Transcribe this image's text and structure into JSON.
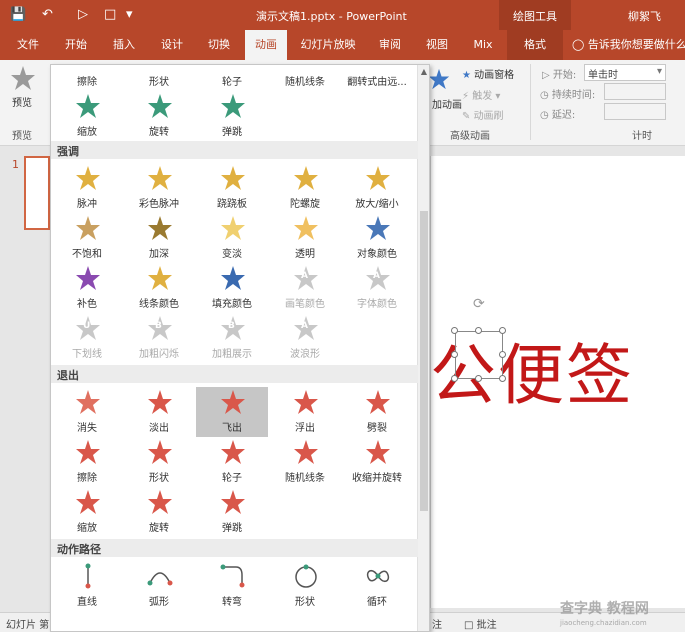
{
  "titlebar": {
    "title": "演示文稿1.pptx - PowerPoint",
    "context_tools": "绘图工具",
    "user": "柳絮飞"
  },
  "tabs": [
    "文件",
    "开始",
    "插入",
    "设计",
    "切换",
    "动画",
    "幻灯片放映",
    "审阅",
    "视图",
    "Mix",
    "格式"
  ],
  "active_tab": "动画",
  "tell_me": "告诉我你想要做什么...",
  "ribbon": {
    "preview": {
      "button": "预览",
      "group": "预览"
    },
    "add_animation": "加动画",
    "animation_pane": "动画窗格",
    "trigger": "触发",
    "animation_painter": "动画刷",
    "advanced_group": "高级动画",
    "timing": {
      "start_label": "开始:",
      "start_value": "单击时",
      "duration_label": "持续时间:",
      "delay_label": "延迟:",
      "group": "计时"
    }
  },
  "slide": {
    "number": "1",
    "text": "公便签"
  },
  "status": {
    "slide_info": "幻灯片 第",
    "notes": "注",
    "comments": "批注"
  },
  "gallery": {
    "top_labels": [
      "擦除",
      "形状",
      "轮子",
      "随机线条",
      "翻转式由远..."
    ],
    "top_row": [
      {
        "label": "缩放",
        "color": "#3b9a7a"
      },
      {
        "label": "旋转",
        "color": "#3b9a7a"
      },
      {
        "label": "弹跳",
        "color": "#3b9a7a"
      }
    ],
    "sections": [
      {
        "title": "强调",
        "rows": [
          [
            {
              "label": "脉冲",
              "color": "#e0b040"
            },
            {
              "label": "彩色脉冲",
              "color": "#e0b040"
            },
            {
              "label": "跷跷板",
              "color": "#e0b040"
            },
            {
              "label": "陀螺旋",
              "color": "#e0b040"
            },
            {
              "label": "放大/缩小",
              "color": "#e0b040"
            }
          ],
          [
            {
              "label": "不饱和",
              "color": "#c9a060"
            },
            {
              "label": "加深",
              "color": "#9a7a30"
            },
            {
              "label": "变淡",
              "color": "#f0d070"
            },
            {
              "label": "透明",
              "color": "#f0c060"
            },
            {
              "label": "对象颜色",
              "color": "#4a78b8"
            }
          ],
          [
            {
              "label": "补色",
              "color": "#8a4ab0"
            },
            {
              "label": "线条颜色",
              "color": "#e0b040"
            },
            {
              "label": "填充颜色",
              "color": "#3a6ab0"
            },
            {
              "label": "画笔颜色",
              "color": "#c8c8c8",
              "disabled": true,
              "letter": "A"
            },
            {
              "label": "字体颜色",
              "color": "#c8c8c8",
              "disabled": true,
              "letter": "A"
            }
          ],
          [
            {
              "label": "下划线",
              "color": "#c8c8c8",
              "disabled": true,
              "letter": "U"
            },
            {
              "label": "加粗闪烁",
              "color": "#c8c8c8",
              "disabled": true,
              "letter": "B"
            },
            {
              "label": "加粗展示",
              "color": "#c8c8c8",
              "disabled": true,
              "letter": "B"
            },
            {
              "label": "波浪形",
              "color": "#c8c8c8",
              "disabled": true,
              "letter": "A"
            }
          ]
        ]
      },
      {
        "title": "退出",
        "rows": [
          [
            {
              "label": "消失",
              "color": "#e07060"
            },
            {
              "label": "淡出",
              "color": "#d9574a"
            },
            {
              "label": "飞出",
              "color": "#d9574a",
              "selected": true
            },
            {
              "label": "浮出",
              "color": "#d9574a"
            },
            {
              "label": "劈裂",
              "color": "#d9574a"
            }
          ],
          [
            {
              "label": "擦除",
              "color": "#d9574a"
            },
            {
              "label": "形状",
              "color": "#d9574a"
            },
            {
              "label": "轮子",
              "color": "#d9574a"
            },
            {
              "label": "随机线条",
              "color": "#d9574a"
            },
            {
              "label": "收缩并旋转",
              "color": "#d9574a"
            }
          ],
          [
            {
              "label": "缩放",
              "color": "#d9574a"
            },
            {
              "label": "旋转",
              "color": "#d9574a"
            },
            {
              "label": "弹跳",
              "color": "#d9574a"
            }
          ]
        ]
      },
      {
        "title": "动作路径",
        "rows": [
          [
            {
              "label": "直线",
              "color": "#3b9a7a",
              "path": "line"
            },
            {
              "label": "弧形",
              "color": "#3b9a7a",
              "path": "arc"
            },
            {
              "label": "转弯",
              "color": "#3b9a7a",
              "path": "turn"
            },
            {
              "label": "形状",
              "color": "#3b9a7a",
              "path": "circle"
            },
            {
              "label": "循环",
              "color": "#3b9a7a",
              "path": "loop"
            }
          ]
        ]
      }
    ]
  },
  "watermark": {
    "main": "查字典 教程网",
    "sub": "jiaocheng.chazidian.com"
  }
}
